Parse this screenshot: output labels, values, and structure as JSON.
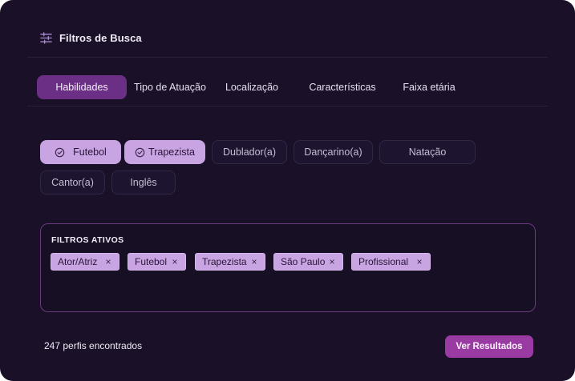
{
  "header": {
    "icon": "sliders-icon",
    "title": "Filtros de Busca"
  },
  "tabs": [
    {
      "label": "Habilidades",
      "active": true
    },
    {
      "label": "Tipo de Atuação",
      "active": false
    },
    {
      "label": "Localização",
      "active": false
    },
    {
      "label": "Características",
      "active": false
    },
    {
      "label": "Faixa etária",
      "active": false
    }
  ],
  "skills": [
    {
      "label": "Futebol",
      "selected": true
    },
    {
      "label": "Trapezista",
      "selected": true
    },
    {
      "label": "Dublador(a)",
      "selected": false
    },
    {
      "label": "Dançarino(a)",
      "selected": false
    },
    {
      "label": "Natação",
      "selected": false
    },
    {
      "label": "Cantor(a)",
      "selected": false
    },
    {
      "label": "Inglês",
      "selected": false
    }
  ],
  "active_filters": {
    "title": "FILTROS ATIVOS",
    "tags": [
      {
        "label": "Ator/Atriz",
        "remove": "×"
      },
      {
        "label": "Futebol",
        "remove": "×"
      },
      {
        "label": "Trapezista",
        "remove": "×"
      },
      {
        "label": "São Paulo",
        "remove": "×"
      },
      {
        "label": "Profissional",
        "remove": "×"
      }
    ]
  },
  "footer": {
    "count_text": "247 perfis encontrados",
    "button_label": "Ver Resultados"
  },
  "colors": {
    "background": "#1a1128",
    "accent": "#6b2f86",
    "chip_selected": "#c8a4e2",
    "button": "#9a3aa3"
  }
}
